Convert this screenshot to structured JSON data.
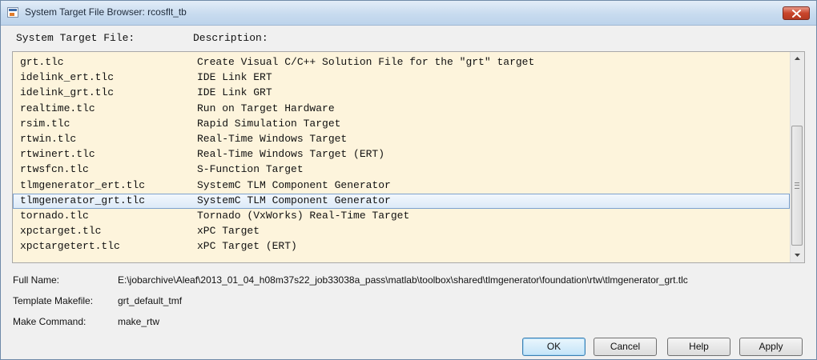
{
  "window": {
    "title": "System Target File Browser: rcosflt_tb"
  },
  "headers": {
    "file": "System Target File:",
    "description": "Description:"
  },
  "rows": [
    {
      "file": "grt.tlc",
      "desc": "Create Visual C/C++ Solution File for the \"grt\" target"
    },
    {
      "file": "idelink_ert.tlc",
      "desc": "IDE Link ERT"
    },
    {
      "file": "idelink_grt.tlc",
      "desc": "IDE Link GRT"
    },
    {
      "file": "realtime.tlc",
      "desc": "Run on Target Hardware"
    },
    {
      "file": "rsim.tlc",
      "desc": "Rapid Simulation Target"
    },
    {
      "file": "rtwin.tlc",
      "desc": "Real-Time Windows Target"
    },
    {
      "file": "rtwinert.tlc",
      "desc": "Real-Time Windows Target (ERT)"
    },
    {
      "file": "rtwsfcn.tlc",
      "desc": "S-Function Target"
    },
    {
      "file": "tlmgenerator_ert.tlc",
      "desc": "SystemC TLM Component Generator"
    },
    {
      "file": "tlmgenerator_grt.tlc",
      "desc": "SystemC TLM Component Generator"
    },
    {
      "file": "tornado.tlc",
      "desc": "Tornado (VxWorks) Real-Time Target"
    },
    {
      "file": "xpctarget.tlc",
      "desc": "xPC Target"
    },
    {
      "file": "xpctargetert.tlc",
      "desc": "xPC Target (ERT)"
    }
  ],
  "selected_row": "tlmgenerator_grt.tlc",
  "details": {
    "full_name_label": "Full Name:",
    "full_name_value": "E:\\jobarchive\\Aleaf\\2013_01_04_h08m37s22_job33038a_pass\\matlab\\toolbox\\shared\\tlmgenerator\\foundation\\rtw\\tlmgenerator_grt.tlc",
    "template_label": "Template Makefile:",
    "template_value": "grt_default_tmf",
    "make_label": "Make Command:",
    "make_value": "make_rtw"
  },
  "buttons": {
    "ok": "OK",
    "cancel": "Cancel",
    "help": "Help",
    "apply": "Apply"
  },
  "colors": {
    "list_background": "#fdf4dc",
    "selection": "#dbe9f7",
    "close_button": "#c9452b"
  },
  "icons": {
    "app": "matlab-window-icon",
    "close": "close-icon"
  }
}
